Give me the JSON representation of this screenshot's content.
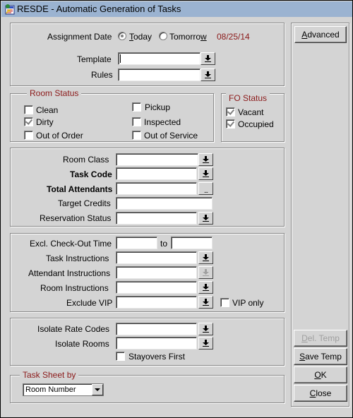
{
  "window": {
    "title": "RESDE - Automatic Generation of Tasks",
    "icon": "app-icon"
  },
  "assignment": {
    "label": "Assignment Date",
    "options": [
      {
        "label_pre": "",
        "mnemonic": "T",
        "label_post": "oday",
        "checked": true
      },
      {
        "label_pre": "Tomorro",
        "mnemonic": "w",
        "label_post": "",
        "checked": false
      }
    ],
    "date": "08/25/14",
    "template_label": "Template",
    "template_value": "",
    "rules_label": "Rules",
    "rules_value": ""
  },
  "room_status": {
    "legend": "Room Status",
    "items": [
      {
        "label": "Clean",
        "checked": false
      },
      {
        "label": "Dirty",
        "checked": true
      },
      {
        "label": "Out of Order",
        "checked": false
      },
      {
        "label": "Pickup",
        "checked": false
      },
      {
        "label": "Inspected",
        "checked": false
      },
      {
        "label": "Out of Service",
        "checked": false
      }
    ]
  },
  "fo_status": {
    "legend": "FO Status",
    "items": [
      {
        "label": "Vacant",
        "checked": true
      },
      {
        "label": "Occupied",
        "checked": true
      }
    ]
  },
  "task_fields": {
    "room_class": {
      "label": "Room Class",
      "value": ""
    },
    "task_code": {
      "label": "Task Code",
      "value": ""
    },
    "total_attendants": {
      "label": "Total Attendants",
      "value": "",
      "button": "..."
    },
    "target_credits": {
      "label": "Target Credits",
      "value": ""
    },
    "reservation_status": {
      "label": "Reservation Status",
      "value": ""
    }
  },
  "instructions": {
    "checkout_time": {
      "label": "Excl. Check-Out Time",
      "from": "",
      "to_label": "to",
      "to": ""
    },
    "task_instructions": {
      "label": "Task Instructions",
      "value": ""
    },
    "attendant_instructions": {
      "label": "Attendant Instructions",
      "value": ""
    },
    "room_instructions": {
      "label": "Room Instructions",
      "value": ""
    },
    "exclude_vip": {
      "label": "Exclude VIP",
      "value": ""
    },
    "vip_only": {
      "label": "VIP only",
      "checked": false
    }
  },
  "isolate": {
    "rate_codes": {
      "label": "Isolate Rate Codes",
      "value": ""
    },
    "rooms": {
      "label": "Isolate Rooms",
      "value": ""
    },
    "stayovers_first": {
      "label": "Stayovers First",
      "checked": false
    }
  },
  "task_sheet": {
    "legend": "Task Sheet by",
    "selected": "Room Number"
  },
  "buttons": {
    "advanced": {
      "mnemonic": "A",
      "rest": "dvanced",
      "enabled": true
    },
    "del_temp": {
      "mnemonic": "D",
      "rest": "el. Temp",
      "enabled": false
    },
    "save_temp": {
      "mnemonic": "S",
      "rest": "ave Temp",
      "enabled": true
    },
    "ok": {
      "mnemonic": "O",
      "rest": "K",
      "enabled": true
    },
    "close": {
      "mnemonic": "C",
      "rest": "lose",
      "enabled": true
    }
  }
}
